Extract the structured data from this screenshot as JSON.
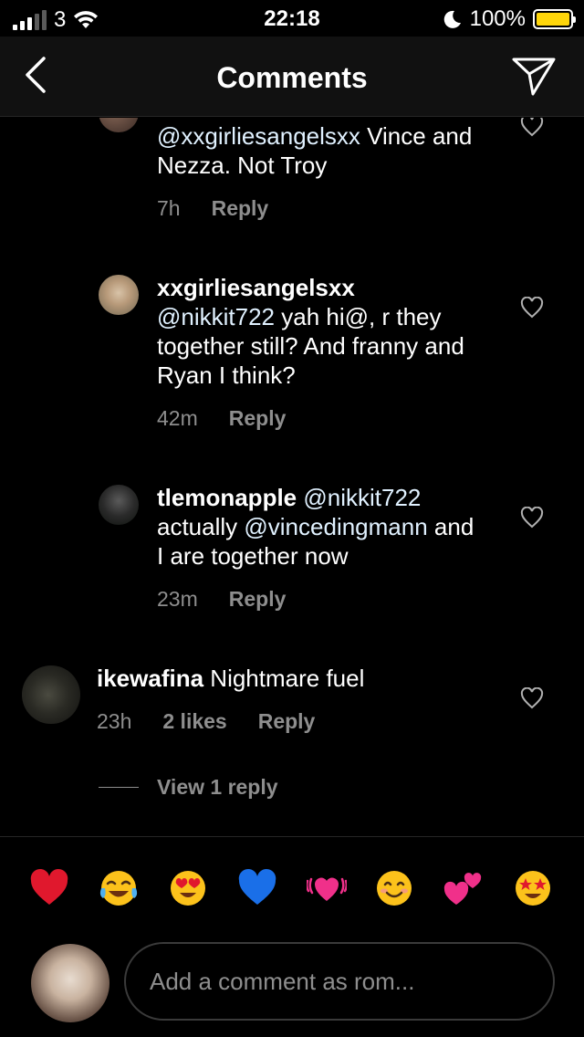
{
  "status_bar": {
    "carrier": "3",
    "time": "22:18",
    "battery": "100%",
    "battery_color": "#ffd60a"
  },
  "nav": {
    "title": "Comments",
    "back_icon": "chevron-left-icon",
    "send_icon": "paper-plane-icon"
  },
  "comments": [
    {
      "username": "",
      "text": "@xxgirliesangelsxx Vince and Nezza. Not Troy",
      "time": "7h",
      "reply_label": "Reply"
    },
    {
      "username": "xxgirliesangelsxx",
      "text": "@nikkit722 yah hi@, r they together still? And franny and Ryan I think?",
      "time": "42m",
      "reply_label": "Reply"
    },
    {
      "username": "tlemonapple",
      "text": "@nikkit722 actually @vincedingmann and I are together now",
      "time": "23m",
      "reply_label": "Reply"
    },
    {
      "username": "ikewafina",
      "text": "Nightmare fuel",
      "time": "23h",
      "likes": "2 likes",
      "reply_label": "Reply",
      "view_replies": "View 1 reply"
    }
  ],
  "emoji_bar": [
    "❤️",
    "😂",
    "😍",
    "💙",
    "💓",
    "😊",
    "💕",
    "🤩"
  ],
  "input": {
    "placeholder": "Add a comment as rom..."
  }
}
